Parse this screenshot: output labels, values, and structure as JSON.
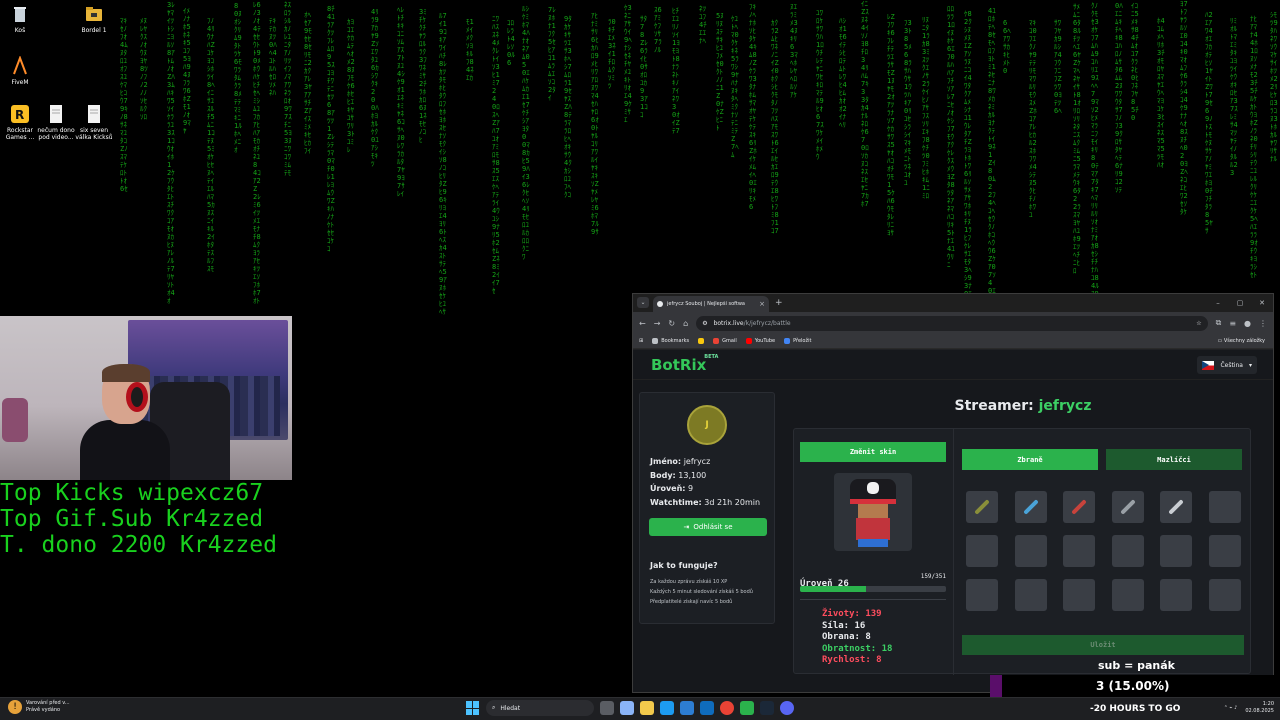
{
  "desktop": {
    "icons": [
      {
        "label": "Koš"
      },
      {
        "label": "Bordel 1"
      },
      {
        "label": "FiveM"
      },
      {
        "label": "Rockstar Games ..."
      },
      {
        "label": "nečum dono pod video..."
      },
      {
        "label": "six seven válka Kicksů"
      }
    ]
  },
  "overlay": {
    "line1": "Top Kicks wipexcz67",
    "line2": "Top Gif.Sub Kr4zzed",
    "line3": "T. dono 2200 Kr4zzed"
  },
  "browser": {
    "tab_title": "jefrycz Souboj | Nejlepší softwa",
    "url_host": "botrix.live",
    "url_path": "/k/jefrycz/battle",
    "bookmarks": [
      "Bookmarks",
      "Gmail",
      "YouTube",
      "Přeložit"
    ],
    "bookmarks_right": "Všechny záložky"
  },
  "site": {
    "logo": "BotRix",
    "logo_badge": "BETA",
    "language": "Čeština",
    "profile": {
      "avatar_text": "J",
      "name_label": "Jméno:",
      "name_value": "jefrycz",
      "points_label": "Body:",
      "points_value": "13,100",
      "level_label": "Úroveň:",
      "level_value": "9",
      "watchtime_label": "Watchtime:",
      "watchtime_value": "3d 21h 20min",
      "logout_label": "Odhlásit se"
    },
    "howto": {
      "title": "Jak to funguje?",
      "line1": "Za každou zprávu získáš 10 XP",
      "line2": "Každých 5 minut sledování získáš 5 bodů",
      "line3": "Předplatitelé získají navíc 5 bodů"
    },
    "streamer_label": "Streamer:",
    "streamer_name": "jefrycz",
    "battle": {
      "change_skin": "Změnit skin",
      "level_label": "Úroveň 26",
      "xp_text": "159/351",
      "xp_fraction": 0.453,
      "stats": [
        {
          "label": "Životy: 139",
          "color": "red"
        },
        {
          "label": "Síla: 16",
          "color": "white"
        },
        {
          "label": "Obrana: 8",
          "color": "white"
        },
        {
          "label": "Obratnost: 18",
          "color": "green"
        },
        {
          "label": "Rychlost: 8",
          "color": "red"
        }
      ],
      "tab_weapons": "Zbraně",
      "tab_pets": "Mazlíčci",
      "save": "Uložit",
      "slots": [
        {
          "item": "crossbow",
          "color": "#8a8f3a"
        },
        {
          "item": "blue-sword",
          "color": "#4aa3d8"
        },
        {
          "item": "red-dagger",
          "color": "#c7433c"
        },
        {
          "item": "axe",
          "color": "#9aa0a6"
        },
        {
          "item": "knife",
          "color": "#c9cdd2"
        },
        {
          "item": "empty",
          "color": ""
        },
        {
          "item": "empty",
          "color": ""
        },
        {
          "item": "empty",
          "color": ""
        },
        {
          "item": "empty",
          "color": ""
        },
        {
          "item": "empty",
          "color": ""
        },
        {
          "item": "empty",
          "color": ""
        },
        {
          "item": "empty",
          "color": ""
        },
        {
          "item": "empty",
          "color": ""
        },
        {
          "item": "empty",
          "color": ""
        },
        {
          "item": "empty",
          "color": ""
        },
        {
          "item": "empty",
          "color": ""
        },
        {
          "item": "empty",
          "color": ""
        },
        {
          "item": "empty",
          "color": ""
        }
      ]
    }
  },
  "subgoal": {
    "title": "sub = panák",
    "progress_text": "3 (15.00%)",
    "progress_fraction": 0.15,
    "start": "0",
    "marquee": "-20 HOURS TO GO"
  },
  "taskbar": {
    "notif_title": "Varování před v...",
    "notif_sub": "Právě vydáno",
    "search_placeholder": "Hledat",
    "time": "1:20",
    "date": "02.08.2025"
  }
}
